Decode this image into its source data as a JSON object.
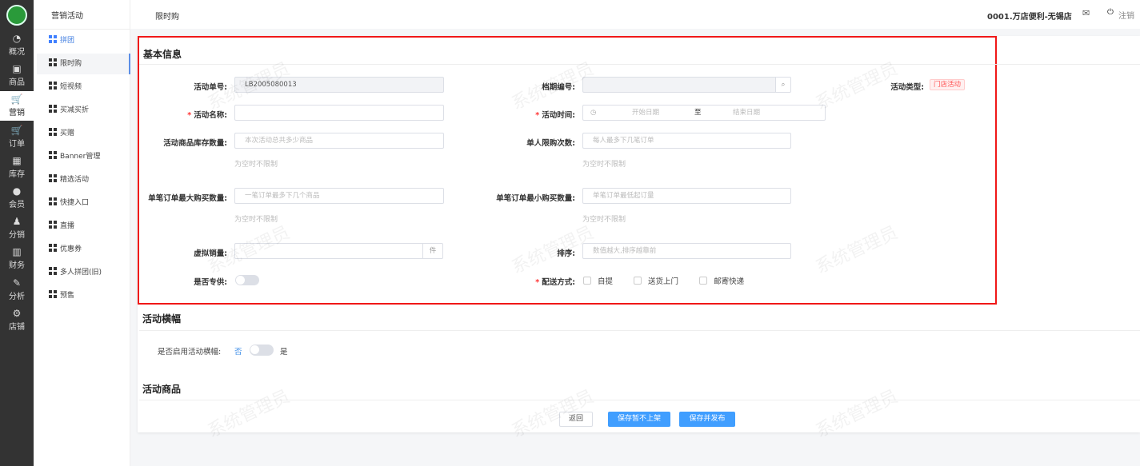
{
  "nav": [
    {
      "label": "概况",
      "icon": "dashboard-icon",
      "glyph": "◔"
    },
    {
      "label": "商品",
      "icon": "product-icon",
      "glyph": "▣"
    },
    {
      "label": "营销",
      "icon": "cart-icon",
      "glyph": "🛒"
    },
    {
      "label": "订单",
      "icon": "order-icon",
      "glyph": "🛒"
    },
    {
      "label": "库存",
      "icon": "stock-icon",
      "glyph": "▦"
    },
    {
      "label": "会员",
      "icon": "member-icon",
      "glyph": "●"
    },
    {
      "label": "分销",
      "icon": "distribution-icon",
      "glyph": "♟"
    },
    {
      "label": "财务",
      "icon": "finance-icon",
      "glyph": "▥"
    },
    {
      "label": "分析",
      "icon": "analysis-icon",
      "glyph": "✎"
    },
    {
      "label": "店铺",
      "icon": "gear-icon",
      "glyph": "⚙"
    }
  ],
  "submenu": {
    "title": "营销活动",
    "items": [
      "拼团",
      "限时购",
      "短视频",
      "买减买折",
      "买赠",
      "Banner管理",
      "精选活动",
      "快捷入口",
      "直播",
      "优惠券",
      "多人拼团(旧)",
      "预售"
    ]
  },
  "header": {
    "page": "限时购",
    "store": "0001.万店便利-无锡店",
    "logout": "注销"
  },
  "basic": {
    "title": "基本信息",
    "order_no_label": "活动单号:",
    "order_no": "LB2005080013",
    "schedule_label": "档期编号:",
    "schedule_value": "",
    "type_label": "活动类型:",
    "type_tag": "门店活动",
    "name_label": "活动名称:",
    "name_value": "",
    "time_label": "活动时间:",
    "start_ph": "开始日期",
    "to": "至",
    "end_ph": "结束日期",
    "stock_label": "活动商品库存数量:",
    "stock_ph": "本次活动总共多少商品",
    "limit_label": "单人限购次数:",
    "limit_ph": "每人最多下几笔订单",
    "hint": "为空时不限制",
    "max_label": "单笔订单最大购买数量:",
    "max_ph": "一笔订单最多下几个商品",
    "min_label": "单笔订单最小购买数量:",
    "min_ph": "单笔订单最低起订量",
    "virtual_label": "虚拟销量:",
    "virtual_unit": "件",
    "sort_label": "排序:",
    "sort_ph": "数值越大,排序越靠前",
    "exclusive_label": "是否专供:",
    "exclusive_on": false,
    "delivery_label": "配送方式:",
    "delivery_options": [
      "自提",
      "送货上门",
      "邮寄快递"
    ]
  },
  "banner": {
    "title": "活动横幅",
    "label": "是否启用活动横幅:",
    "off": "否",
    "on": "是",
    "enabled": false
  },
  "goods": {
    "title": "活动商品"
  },
  "actions": {
    "back": "返回",
    "save_draft": "保存暂不上架",
    "save_publish": "保存并发布"
  },
  "watermark": "系统管理员"
}
